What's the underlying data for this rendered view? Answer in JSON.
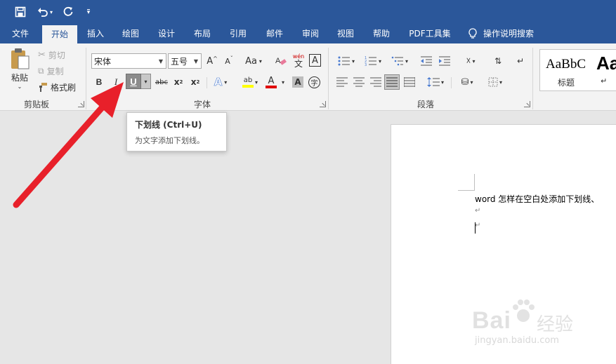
{
  "qat": {
    "save_icon": "save-icon",
    "undo_icon": "undo-icon",
    "redo_icon": "redo-icon",
    "customize_icon": "customize-qat-icon"
  },
  "tabs": [
    {
      "label": "文件"
    },
    {
      "label": "开始"
    },
    {
      "label": "插入"
    },
    {
      "label": "绘图"
    },
    {
      "label": "设计"
    },
    {
      "label": "布局"
    },
    {
      "label": "引用"
    },
    {
      "label": "邮件"
    },
    {
      "label": "审阅"
    },
    {
      "label": "视图"
    },
    {
      "label": "帮助"
    },
    {
      "label": "PDF工具集"
    },
    {
      "label": "操作说明搜索"
    }
  ],
  "clipboard": {
    "paste": "粘贴",
    "cut": "剪切",
    "copy": "复制",
    "format_painter": "格式刷",
    "group_label": "剪贴板"
  },
  "font": {
    "font_name": "宋体",
    "font_size": "五号",
    "grow": "A",
    "shrink": "A",
    "change_case": "Aa",
    "phonetic_top": "wén",
    "phonetic_bottom": "文",
    "char_border": "A",
    "bold": "B",
    "italic": "I",
    "underline": "U",
    "strikethrough": "abc",
    "subscript": "x",
    "superscript": "x",
    "subscript_mark": "2",
    "superscript_mark": "2",
    "text_effects": "A",
    "highlight": "ab",
    "font_color": "A",
    "char_shading": "A",
    "enclose": "字",
    "group_label": "字体"
  },
  "paragraph": {
    "group_label": "段落"
  },
  "styles": {
    "style1_preview": "AaBbC",
    "style1_name": "标题",
    "style2_preview": "Aa",
    "style2_name": "↵"
  },
  "tooltip": {
    "title": "下划线 (Ctrl+U)",
    "desc": "为文字添加下划线。"
  },
  "document": {
    "line1": "word 怎样在空白处添加下划线、",
    "para_mark": "↵"
  },
  "watermark": {
    "brand": "Bai",
    "brand_cn": "经验",
    "url": "jingyan.baidu.com"
  },
  "colors": {
    "title_bar": "#2b579a",
    "ribbon": "#f3f3f3",
    "arrow": "#e8202a",
    "highlight_yellow": "#ffff00",
    "font_red": "#e00000"
  }
}
